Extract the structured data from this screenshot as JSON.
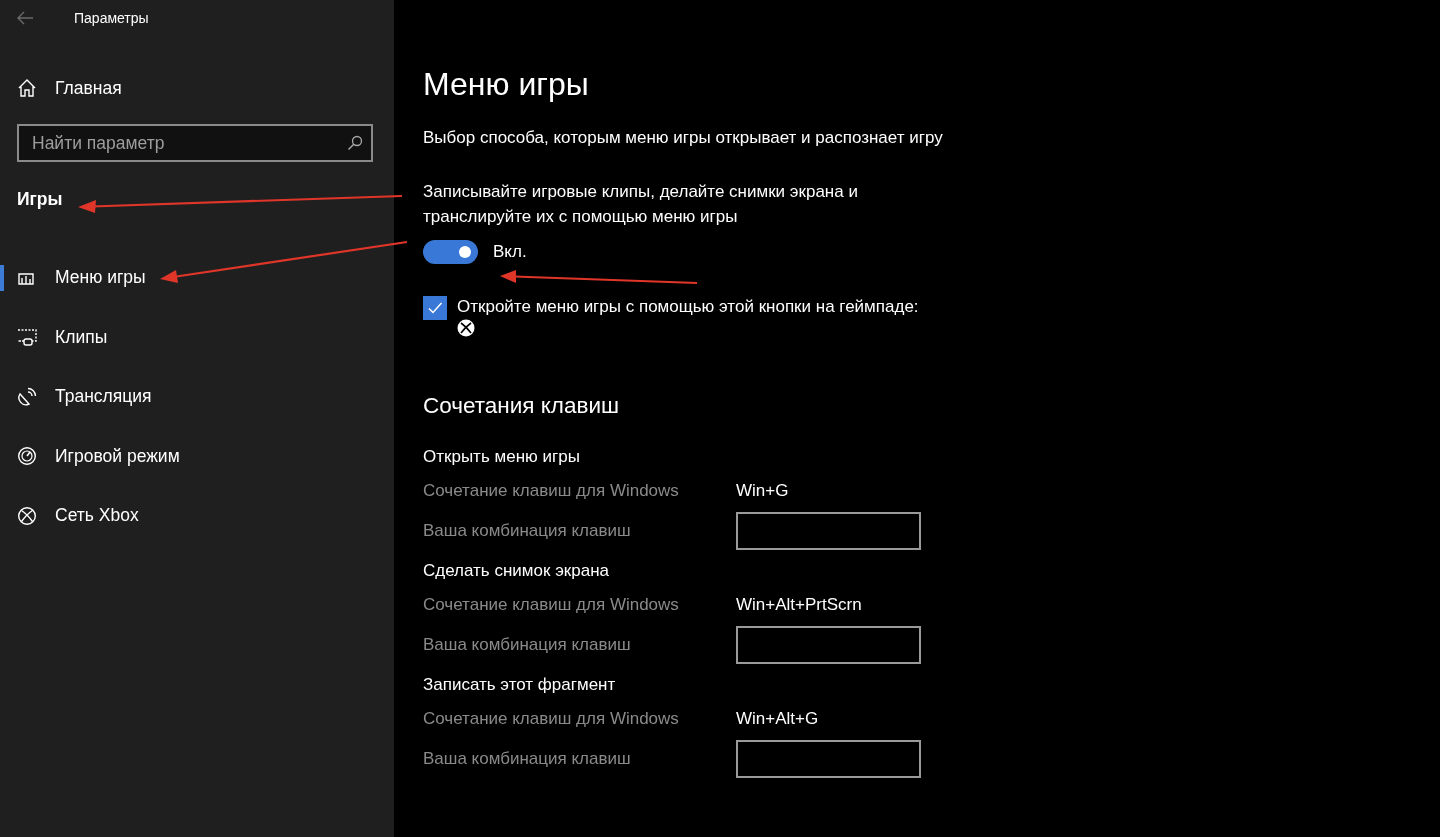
{
  "window": {
    "title": "Параметры"
  },
  "sidebar": {
    "home": "Главная",
    "search": {
      "placeholder": "Найти параметр"
    },
    "section": "Игры",
    "items": [
      {
        "label": "Меню игры",
        "kind": "gamebar",
        "selected": true
      },
      {
        "label": "Клипы",
        "kind": "clips",
        "selected": false
      },
      {
        "label": "Трансляция",
        "kind": "broadcast",
        "selected": false
      },
      {
        "label": "Игровой режим",
        "kind": "gamemode",
        "selected": false
      },
      {
        "label": "Сеть Xbox",
        "kind": "xbox",
        "selected": false
      }
    ]
  },
  "main": {
    "title": "Меню игры",
    "description": "Выбор способа, которым меню игры открывает и распознает игру",
    "toggle": {
      "label": "Записывайте игровые клипы, делайте снимки экрана и транслируйте их с помощью меню игры",
      "on": true,
      "state": "Вкл."
    },
    "checkbox": {
      "label": "Откройте меню игры с помощью этой кнопки на геймпаде:",
      "checked": true
    },
    "shortcuts_title": "Сочетания клавиш",
    "shortcuts": [
      {
        "title": "Открыть меню игры",
        "rows": [
          {
            "kind": "keys",
            "label": "Сочетание клавиш для Windows",
            "value": "Win+G"
          },
          {
            "kind": "field",
            "label": "Ваша комбинация клавиш"
          }
        ]
      },
      {
        "title": "Сделать снимок экрана",
        "rows": [
          {
            "kind": "keys",
            "label": "Сочетание клавиш для Windows",
            "value": "Win+Alt+PrtScrn"
          },
          {
            "kind": "field",
            "label": "Ваша комбинация клавиш"
          }
        ]
      },
      {
        "title": "Записать этот фрагмент",
        "rows": [
          {
            "kind": "keys",
            "label": "Сочетание клавиш для Windows",
            "value": "Win+Alt+G"
          },
          {
            "kind": "field",
            "label": "Ваша комбинация клавиш"
          }
        ]
      }
    ]
  }
}
